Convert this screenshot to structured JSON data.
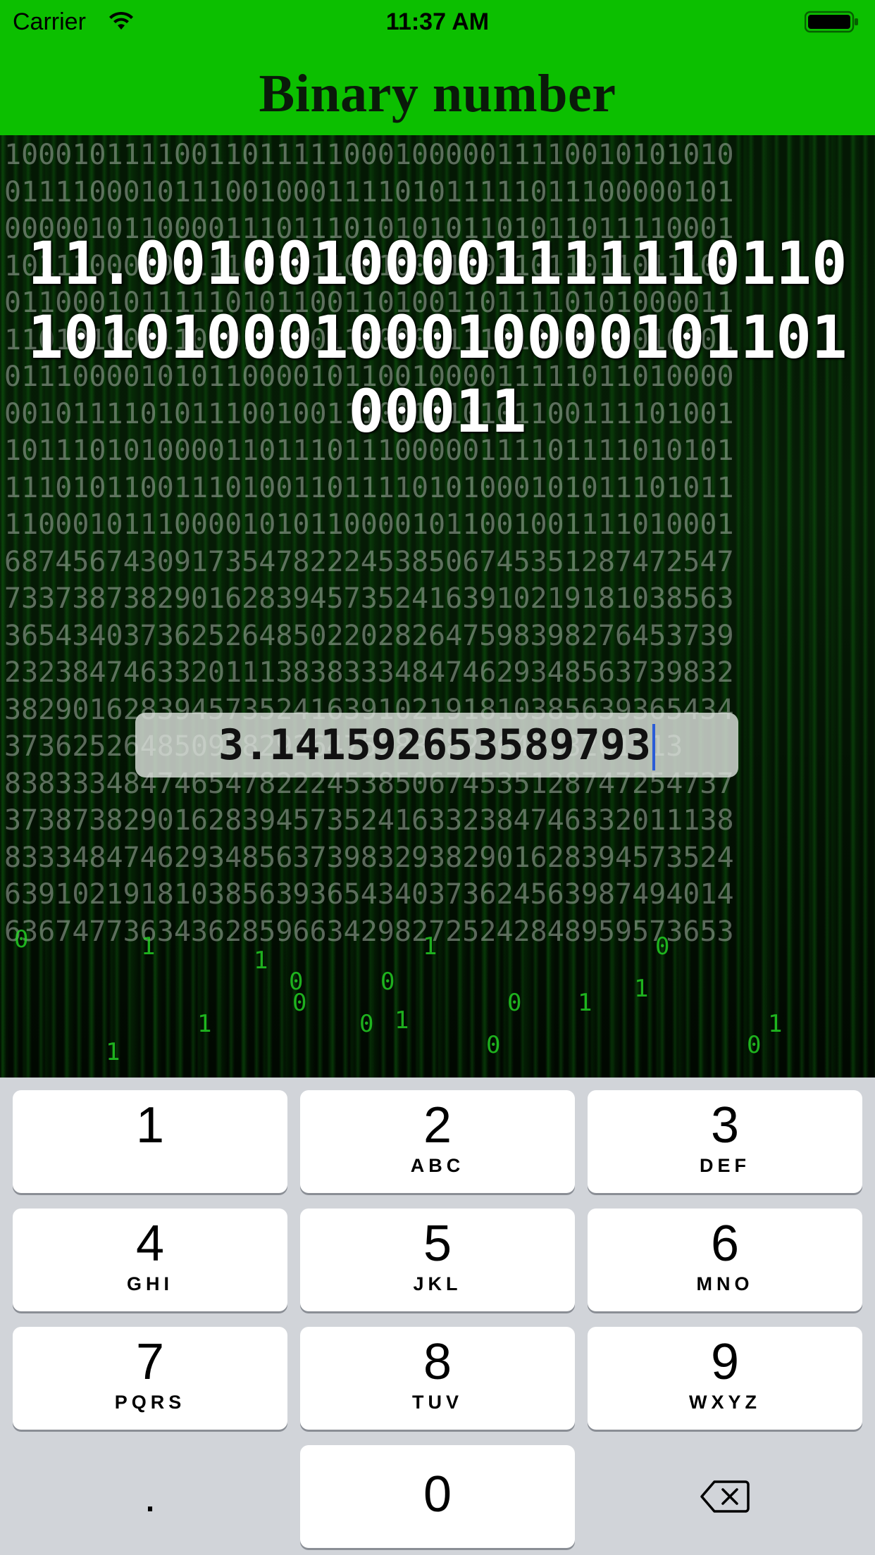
{
  "status_bar": {
    "carrier": "Carrier",
    "time": "11:37 AM"
  },
  "header": {
    "title": "Binary number"
  },
  "result": {
    "binary": "11.001001000011111101101010100010001000010110100011"
  },
  "input": {
    "value": "3.141592653589793"
  },
  "background": {
    "rain_rows": [
      "1000101111001101111100010000011110010101010",
      "0111100010111001000111101011111011100000101",
      "0000010110000111011101010101101011011110001",
      "1011100010111101101100100011011011011011100",
      "0110001011111010110011010011011110101000011",
      "1101010011101011100110000111101000010010001",
      "0111000010101100001011001000011111011010000",
      "0010111101011100100111011110101100111101001",
      "1011101010000110111011100000111101111010101",
      "1110101100111010011011110101000101011101011",
      "1100010111000010101100001011001001111010001",
      "6874567430917354782224538506745351287472547",
      "7337387382901628394573524163910219181038563",
      "3654340373625264850220282647598398276453739",
      "2323847463320111383833348474629348563739832",
      "3829016283945735241639102191810385639365434",
      "3736252648509582926475983982764633201113",
      "8383334847465478222453850674535128747254737",
      "3738738290162839457352416332384746332011138",
      "8333484746293485637398329382901628394573524",
      "6391021918103856393654340373624563987494014",
      "6367477363436285966342982725242848959573653"
    ],
    "scatter_digits": [
      "0",
      "1",
      "1",
      "0",
      "0",
      "1",
      "0",
      "1",
      "0",
      "1",
      "1",
      "0",
      "0",
      "0",
      "1",
      "0",
      "1",
      "1"
    ],
    "accent_color": "#0cbf00"
  },
  "keyboard": {
    "keys": [
      {
        "num": "1",
        "letters": ""
      },
      {
        "num": "2",
        "letters": "ABC"
      },
      {
        "num": "3",
        "letters": "DEF"
      },
      {
        "num": "4",
        "letters": "GHI"
      },
      {
        "num": "5",
        "letters": "JKL"
      },
      {
        "num": "6",
        "letters": "MNO"
      },
      {
        "num": "7",
        "letters": "PQRS"
      },
      {
        "num": "8",
        "letters": "TUV"
      },
      {
        "num": "9",
        "letters": "WXYZ"
      }
    ],
    "dot": ".",
    "zero": "0",
    "backspace_icon": "backspace-icon"
  }
}
